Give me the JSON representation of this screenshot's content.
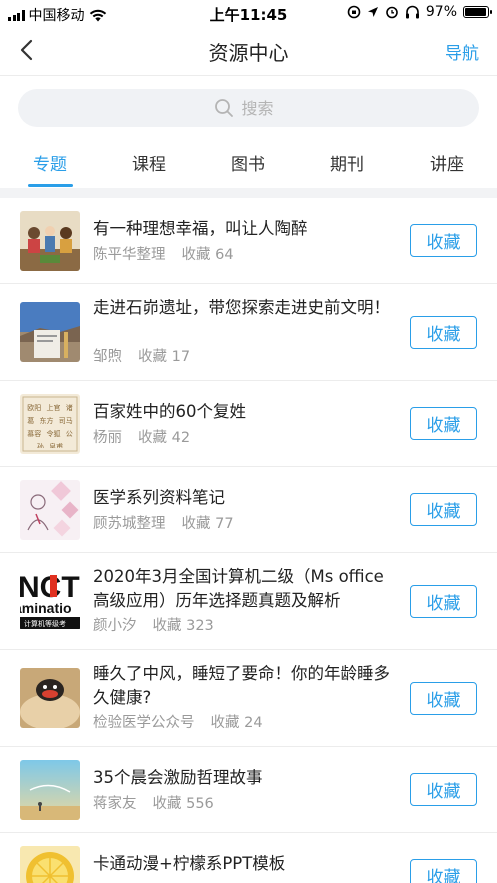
{
  "status_bar": {
    "carrier": "中国移动",
    "time": "上午11:45",
    "battery": "97%",
    "battery_level": 0.97
  },
  "nav": {
    "title": "资源中心",
    "right_link": "导航"
  },
  "search": {
    "placeholder": "搜索"
  },
  "tabs": [
    {
      "label": "专题",
      "active": true
    },
    {
      "label": "课程",
      "active": false
    },
    {
      "label": "图书",
      "active": false
    },
    {
      "label": "期刊",
      "active": false
    },
    {
      "label": "讲座",
      "active": false
    }
  ],
  "items": [
    {
      "title": "有一种理想幸福，叫让人陶醉",
      "author": "陈平华整理",
      "fav": "收藏 64",
      "button": "收藏"
    },
    {
      "title": "走进石峁遗址，带您探索走进史前文明！",
      "author": "邹煦",
      "fav": "收藏 17",
      "button": "收藏"
    },
    {
      "title": "百家姓中的60个复姓",
      "author": "杨丽",
      "fav": "收藏 42",
      "button": "收藏"
    },
    {
      "title": "医学系列资料笔记",
      "author": "顾苏城整理",
      "fav": "收藏 77",
      "button": "收藏"
    },
    {
      "title": "2020年3月全国计算机二级（Ms office高级应用）历年选择题真题及解析",
      "author": "颜小汐",
      "fav": "收藏 323",
      "button": "收藏"
    },
    {
      "title": "睡久了中风，睡短了要命！你的年龄睡多久健康?",
      "author": "检验医学公众号",
      "fav": "收藏 24",
      "button": "收藏"
    },
    {
      "title": "35个晨会激励哲理故事",
      "author": "蒋家友",
      "fav": "收藏 556",
      "button": "收藏"
    },
    {
      "title": "卡通动漫+柠檬系PPT模板",
      "author": "",
      "fav": "",
      "button": "收藏"
    }
  ],
  "thumb_texts": {
    "computer_big": "NCT",
    "computer_mid": "aminatio",
    "computer_small": "计算机等级考",
    "surnames_grid": "欧阳 上官 诸葛 东方 司马 慕容 令狐 公孙 皇甫"
  },
  "colors": {
    "accent": "#2a9ee8",
    "meta_text": "#9a9a9a",
    "divider": "#ececec"
  }
}
